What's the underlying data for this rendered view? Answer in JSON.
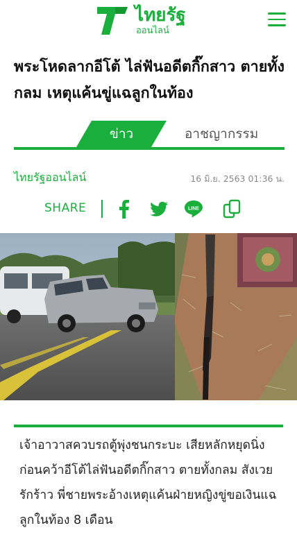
{
  "header": {
    "logo_main": "ไทยรัฐ",
    "logo_sub": "ออนไลน์",
    "brand_color": "#1aaf3c",
    "menu_icon": "hamburger-menu-icon"
  },
  "article": {
    "headline": "พระโหดลากอีโต้ ไล่ฟันอดีตกิ๊กสาว ตายทั้งกลม เหตุแค้นขู่แฉลูกในท้อง",
    "tabs": {
      "active": "ข่าว",
      "other": "อาชญากรรม"
    },
    "source": "ไทยรัฐออนไลน์",
    "date": "16 มิ.ย. 2563 01:36 น.",
    "share": {
      "label": "SHARE",
      "icons": [
        "facebook-icon",
        "twitter-icon",
        "line-icon",
        "copy-link-icon"
      ],
      "line_text": "LINE"
    },
    "lead": "เจ้าอาวาสควบรถตู้พุ่งชนกระบะ เสียหลักหยุดนิ่ง ก่อนคว้าอีโต้ไล่ฟันอดีตกิ๊กสาว ตายทั้งกลม สังเวยรักร้าว พี่ชายพระอ้างเหตุแค้นฝ่ายหญิงขู่ขอเงินแฉลูกในท้อง 8 เดือน"
  }
}
